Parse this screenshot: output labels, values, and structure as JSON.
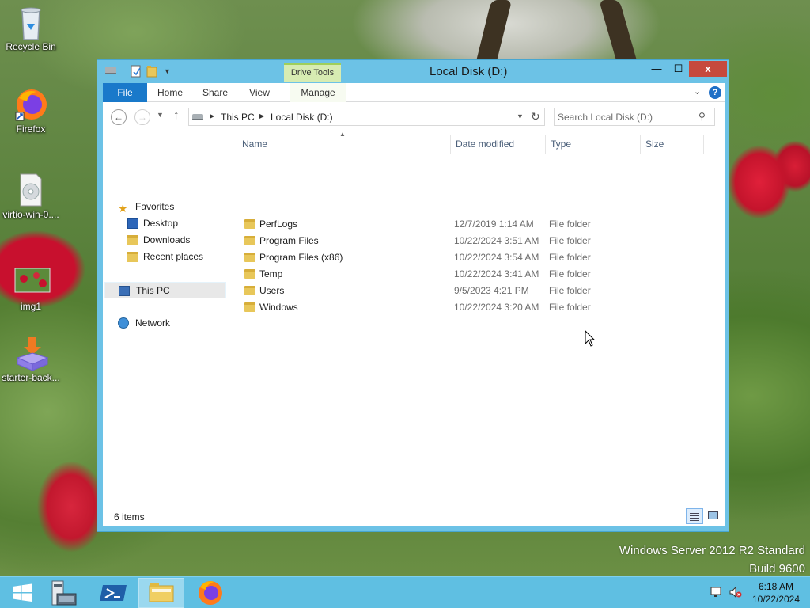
{
  "desktop": {
    "icons": [
      {
        "label": "Recycle Bin",
        "icon": "recycle-bin-icon"
      },
      {
        "label": "Firefox",
        "icon": "firefox-icon"
      },
      {
        "label": "virtio-win-0....",
        "icon": "disc-image-icon"
      },
      {
        "label": "img1",
        "icon": "image-thumbnail-icon"
      },
      {
        "label": "starter-back...",
        "icon": "installer-package-icon"
      }
    ],
    "watermark": {
      "line1": "Windows Server 2012 R2 Standard",
      "line2": "Build 9600"
    }
  },
  "window": {
    "title": "Local Disk (D:)",
    "contextual_tab_group": "Drive Tools",
    "caption": {
      "minimize": "—",
      "maximize": "☐",
      "close": "x"
    },
    "ribbon_tabs": {
      "file": "File",
      "home": "Home",
      "share": "Share",
      "view": "View",
      "manage": "Manage"
    },
    "help_label": "?",
    "address": {
      "crumbs": [
        "This PC",
        "Local Disk (D:)"
      ]
    },
    "search": {
      "placeholder": "Search Local Disk (D:)"
    },
    "navigation": {
      "favorites": "Favorites",
      "desktop": "Desktop",
      "downloads": "Downloads",
      "recent_places": "Recent places",
      "this_pc": "This PC",
      "network": "Network"
    },
    "columns": {
      "name": "Name",
      "date_modified": "Date modified",
      "type": "Type",
      "size": "Size"
    },
    "files": [
      {
        "name": "PerfLogs",
        "date": "12/7/2019 1:14 AM",
        "type": "File folder"
      },
      {
        "name": "Program Files",
        "date": "10/22/2024 3:51 AM",
        "type": "File folder"
      },
      {
        "name": "Program Files (x86)",
        "date": "10/22/2024 3:54 AM",
        "type": "File folder"
      },
      {
        "name": "Temp",
        "date": "10/22/2024 3:41 AM",
        "type": "File folder"
      },
      {
        "name": "Users",
        "date": "9/5/2023 4:21 PM",
        "type": "File folder"
      },
      {
        "name": "Windows",
        "date": "10/22/2024 3:20 AM",
        "type": "File folder"
      }
    ],
    "status": {
      "item_count": "6 items"
    }
  },
  "taskbar": {
    "clock": {
      "time": "6:18 AM",
      "date": "10/22/2024"
    }
  },
  "colors": {
    "window_frame": "#6cc2e6",
    "file_tab": "#1979ca",
    "close_button": "#c6493d",
    "taskbar": "#5fbfe2",
    "drive_tools_accent": "#9fcf5a"
  }
}
